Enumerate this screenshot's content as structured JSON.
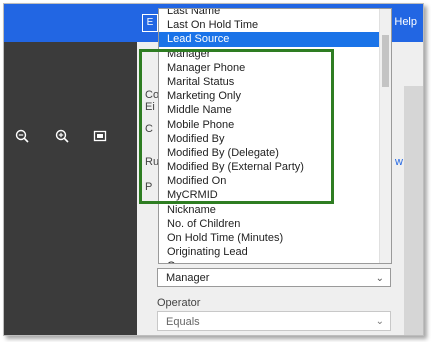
{
  "topbar": {
    "help_label": "Help",
    "badge_glyph": "E"
  },
  "toolbar": {
    "zoom_out_icon": "zoom-out-icon",
    "zoom_in_icon": "zoom-in-icon",
    "fit_icon": "fit-screen-icon"
  },
  "background": {
    "partial_label_1": "Co",
    "partial_label_2": "Ei",
    "partial_label_3": "C",
    "partial_label_4": "Ru",
    "partial_link": "w",
    "partial_label_5": "P"
  },
  "field_select": {
    "value": "Manager"
  },
  "operator": {
    "label": "Operator",
    "value": "Equals"
  },
  "dropdown": {
    "items": [
      "Last Name",
      "Last On Hold Time",
      "Lead Source",
      "Manager",
      "Manager Phone",
      "Marital Status",
      "Marketing Only",
      "Middle Name",
      "Mobile Phone",
      "Modified By",
      "Modified By (Delegate)",
      "Modified By (External Party)",
      "Modified On",
      "MyCRMID",
      "Nickname",
      "No. of Children",
      "On Hold Time (Minutes)",
      "Originating Lead",
      "Owner"
    ],
    "selected_index": 2
  },
  "highlight_color": "#2e7d22"
}
